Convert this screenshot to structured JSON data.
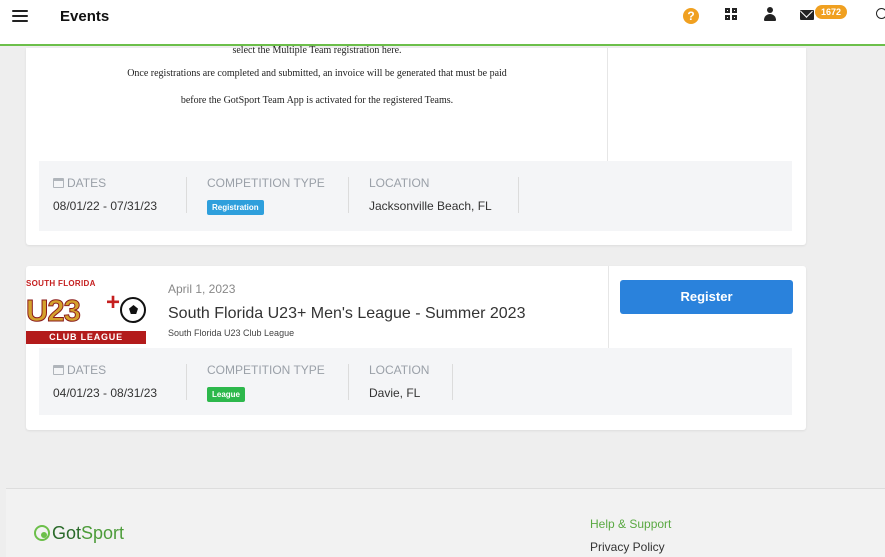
{
  "topbar": {
    "title": "Events",
    "help_icon": "question-circle-icon",
    "mail_badge": "1672"
  },
  "card1": {
    "description": [
      "select the Multiple Team registration here.",
      "Once registrations are completed and submitted, an invoice will be generated that must be paid",
      "before the GotSport Team App is activated for the registered Teams."
    ],
    "dates_label": "DATES",
    "dates_value": "08/01/22 - 07/31/23",
    "type_label": "COMPETITION TYPE",
    "type_tag": "Registration",
    "location_label": "LOCATION",
    "location_value": "Jacksonville Beach, FL"
  },
  "card2": {
    "logo": {
      "top_text": "SOUTH FLORIDA",
      "main_text": "U23",
      "plus": "+",
      "bottom_text": "CLUB LEAGUE"
    },
    "date": "April 1, 2023",
    "title": "South Florida U23+ Men's League - Summer 2023",
    "organizer": "South Florida U23 Club League",
    "register_label": "Register",
    "dates_label": "DATES",
    "dates_value": "04/01/23 - 08/31/23",
    "type_label": "COMPETITION TYPE",
    "type_tag": "League",
    "location_label": "LOCATION",
    "location_value": "Davie, FL"
  },
  "footer": {
    "logo_got": "Got",
    "logo_sport": "Sport",
    "help_link": "Help & Support",
    "privacy_link": "Privacy Policy"
  },
  "colors": {
    "accent_green": "#6cbf4a",
    "register_blue": "#2a82dc",
    "registration_tag": "#2e9fdc",
    "league_tag": "#2db84c",
    "badge_orange": "#f0a020"
  }
}
